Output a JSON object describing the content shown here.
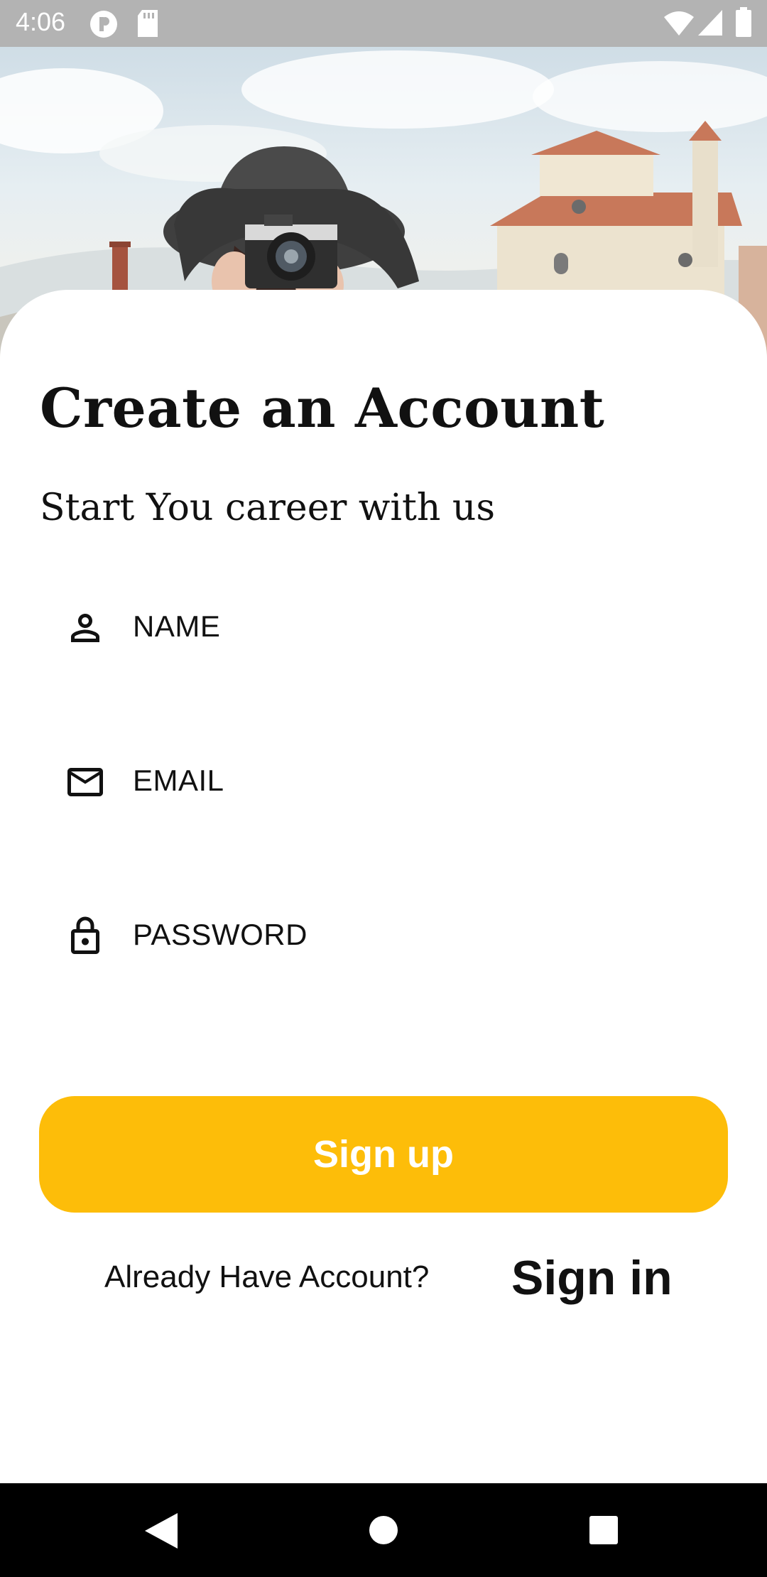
{
  "status_bar": {
    "time": "4:06",
    "icons": [
      "record-icon",
      "sd-card-icon",
      "wifi-icon",
      "signal-icon",
      "battery-icon"
    ]
  },
  "hero": {
    "image": "woman-with-hat-holding-camera-photo"
  },
  "header": {
    "title": "Create an Account",
    "subtitle": "Start You career with us"
  },
  "form": {
    "name": {
      "placeholder": "NAME",
      "icon": "person-icon"
    },
    "email": {
      "placeholder": "EMAIL",
      "icon": "mail-icon"
    },
    "password": {
      "placeholder": "PASSWORD",
      "icon": "lock-icon"
    }
  },
  "actions": {
    "signup_label": "Sign up",
    "already_text": "Already Have Account?",
    "signin_label": "Sign in"
  },
  "colors": {
    "accent": "#FDBD09",
    "text": "#111111",
    "status_bar": "#B3B3B3",
    "nav_bar": "#000000"
  },
  "nav_bar": {
    "buttons": [
      "back-icon",
      "home-icon",
      "recents-icon"
    ]
  }
}
